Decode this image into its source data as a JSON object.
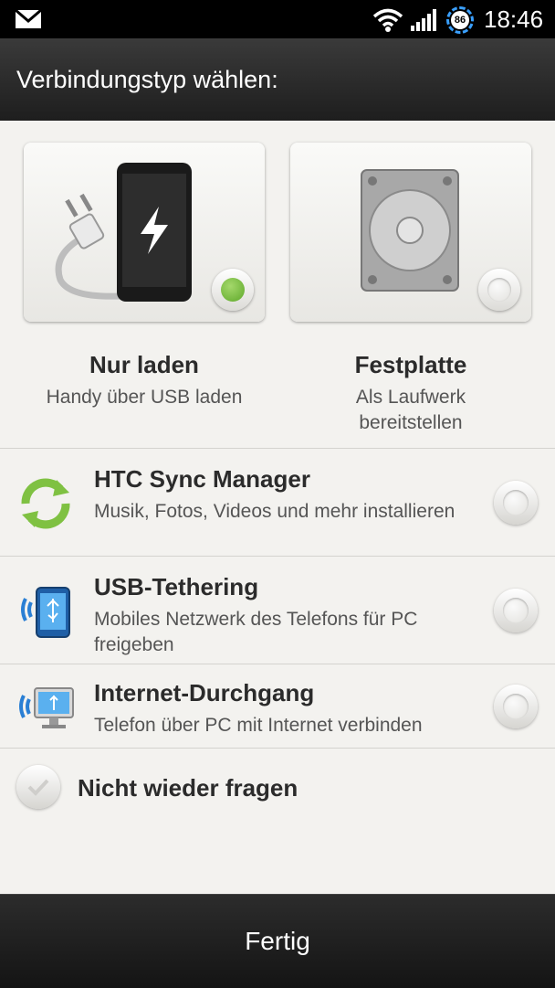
{
  "status": {
    "battery": "86",
    "time": "18:46"
  },
  "dialog": {
    "title": "Verbindungstyp wählen:"
  },
  "cards": [
    {
      "title": "Nur laden",
      "subtitle": "Handy über USB laden",
      "selected": true
    },
    {
      "title": "Festplatte",
      "subtitle": "Als Laufwerk bereitstellen",
      "selected": false
    }
  ],
  "options": [
    {
      "title": "HTC Sync Manager",
      "subtitle": "Musik, Fotos, Videos und mehr installieren",
      "icon": "sync-icon",
      "selected": false
    },
    {
      "title": "USB-Tethering",
      "subtitle": "Mobiles Netzwerk des Telefons für PC freigeben",
      "icon": "usb-tethering-icon",
      "selected": false
    },
    {
      "title": "Internet-Durchgang",
      "subtitle": "Telefon über PC mit Internet verbinden",
      "icon": "internet-passthrough-icon",
      "selected": false
    }
  ],
  "ask_again": {
    "label": "Nicht wieder fragen",
    "checked": false
  },
  "footer": {
    "done_label": "Fertig"
  },
  "colors": {
    "selected_radio": "#6cb233",
    "accent_blue": "#3aa0ff",
    "background": "#f3f2ef"
  }
}
